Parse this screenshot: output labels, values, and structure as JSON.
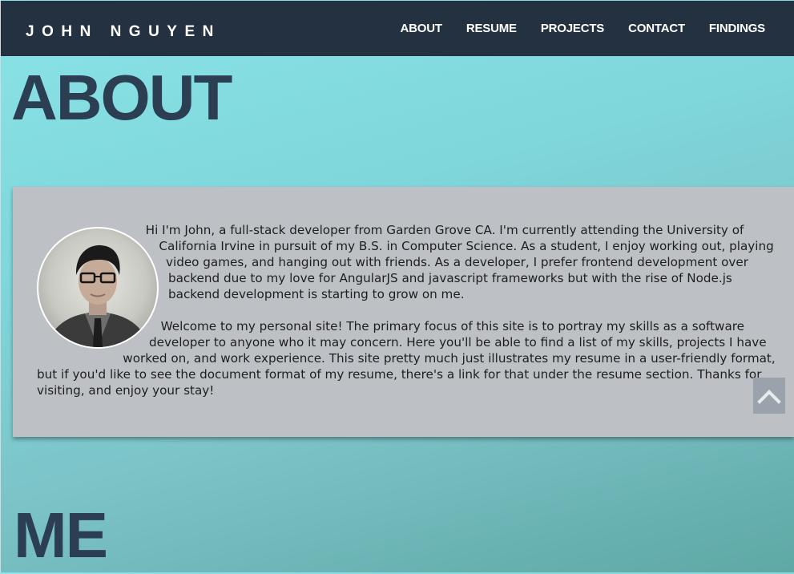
{
  "brand": "JOHN NGUYEN",
  "nav": {
    "items": [
      "ABOUT",
      "RESUME",
      "PROJECTS",
      "CONTACT",
      "FINDINGS"
    ]
  },
  "sections": {
    "about_heading": "ABOUT",
    "me_heading": "ME"
  },
  "about": {
    "paragraph1": "Hi I'm John, a full-stack developer from Garden Grove CA. I'm currently attending the University of California Irvine in pursuit of my B.S. in Computer Science. As a student, I enjoy working out, playing video games, and hanging out with friends. As a developer, I prefer frontend development over backend due to my love for AngularJS and javascript frameworks but with the rise of Node.js backend development is starting to grow on me.",
    "paragraph2": "Welcome to my personal site! The primary focus of this site is to portray my skills as a software developer to anyone who it may concern. Here you'll be able to find a list of my skills, projects I have worked on, and work experience. This site pretty much just illustrates my resume in a user-friendly format, but if you'd like to see the document format of my resume, there's a link for that under the resume section. Thanks for visiting, and enjoy your stay!"
  },
  "icons": {
    "avatar": "profile-photo",
    "scroll_top": "chevron-up-icon"
  },
  "colors": {
    "navbar": "#233141",
    "heading": "#2b3e52",
    "card": "#bdc1c6",
    "scroll_button": "#9aa3ab"
  }
}
